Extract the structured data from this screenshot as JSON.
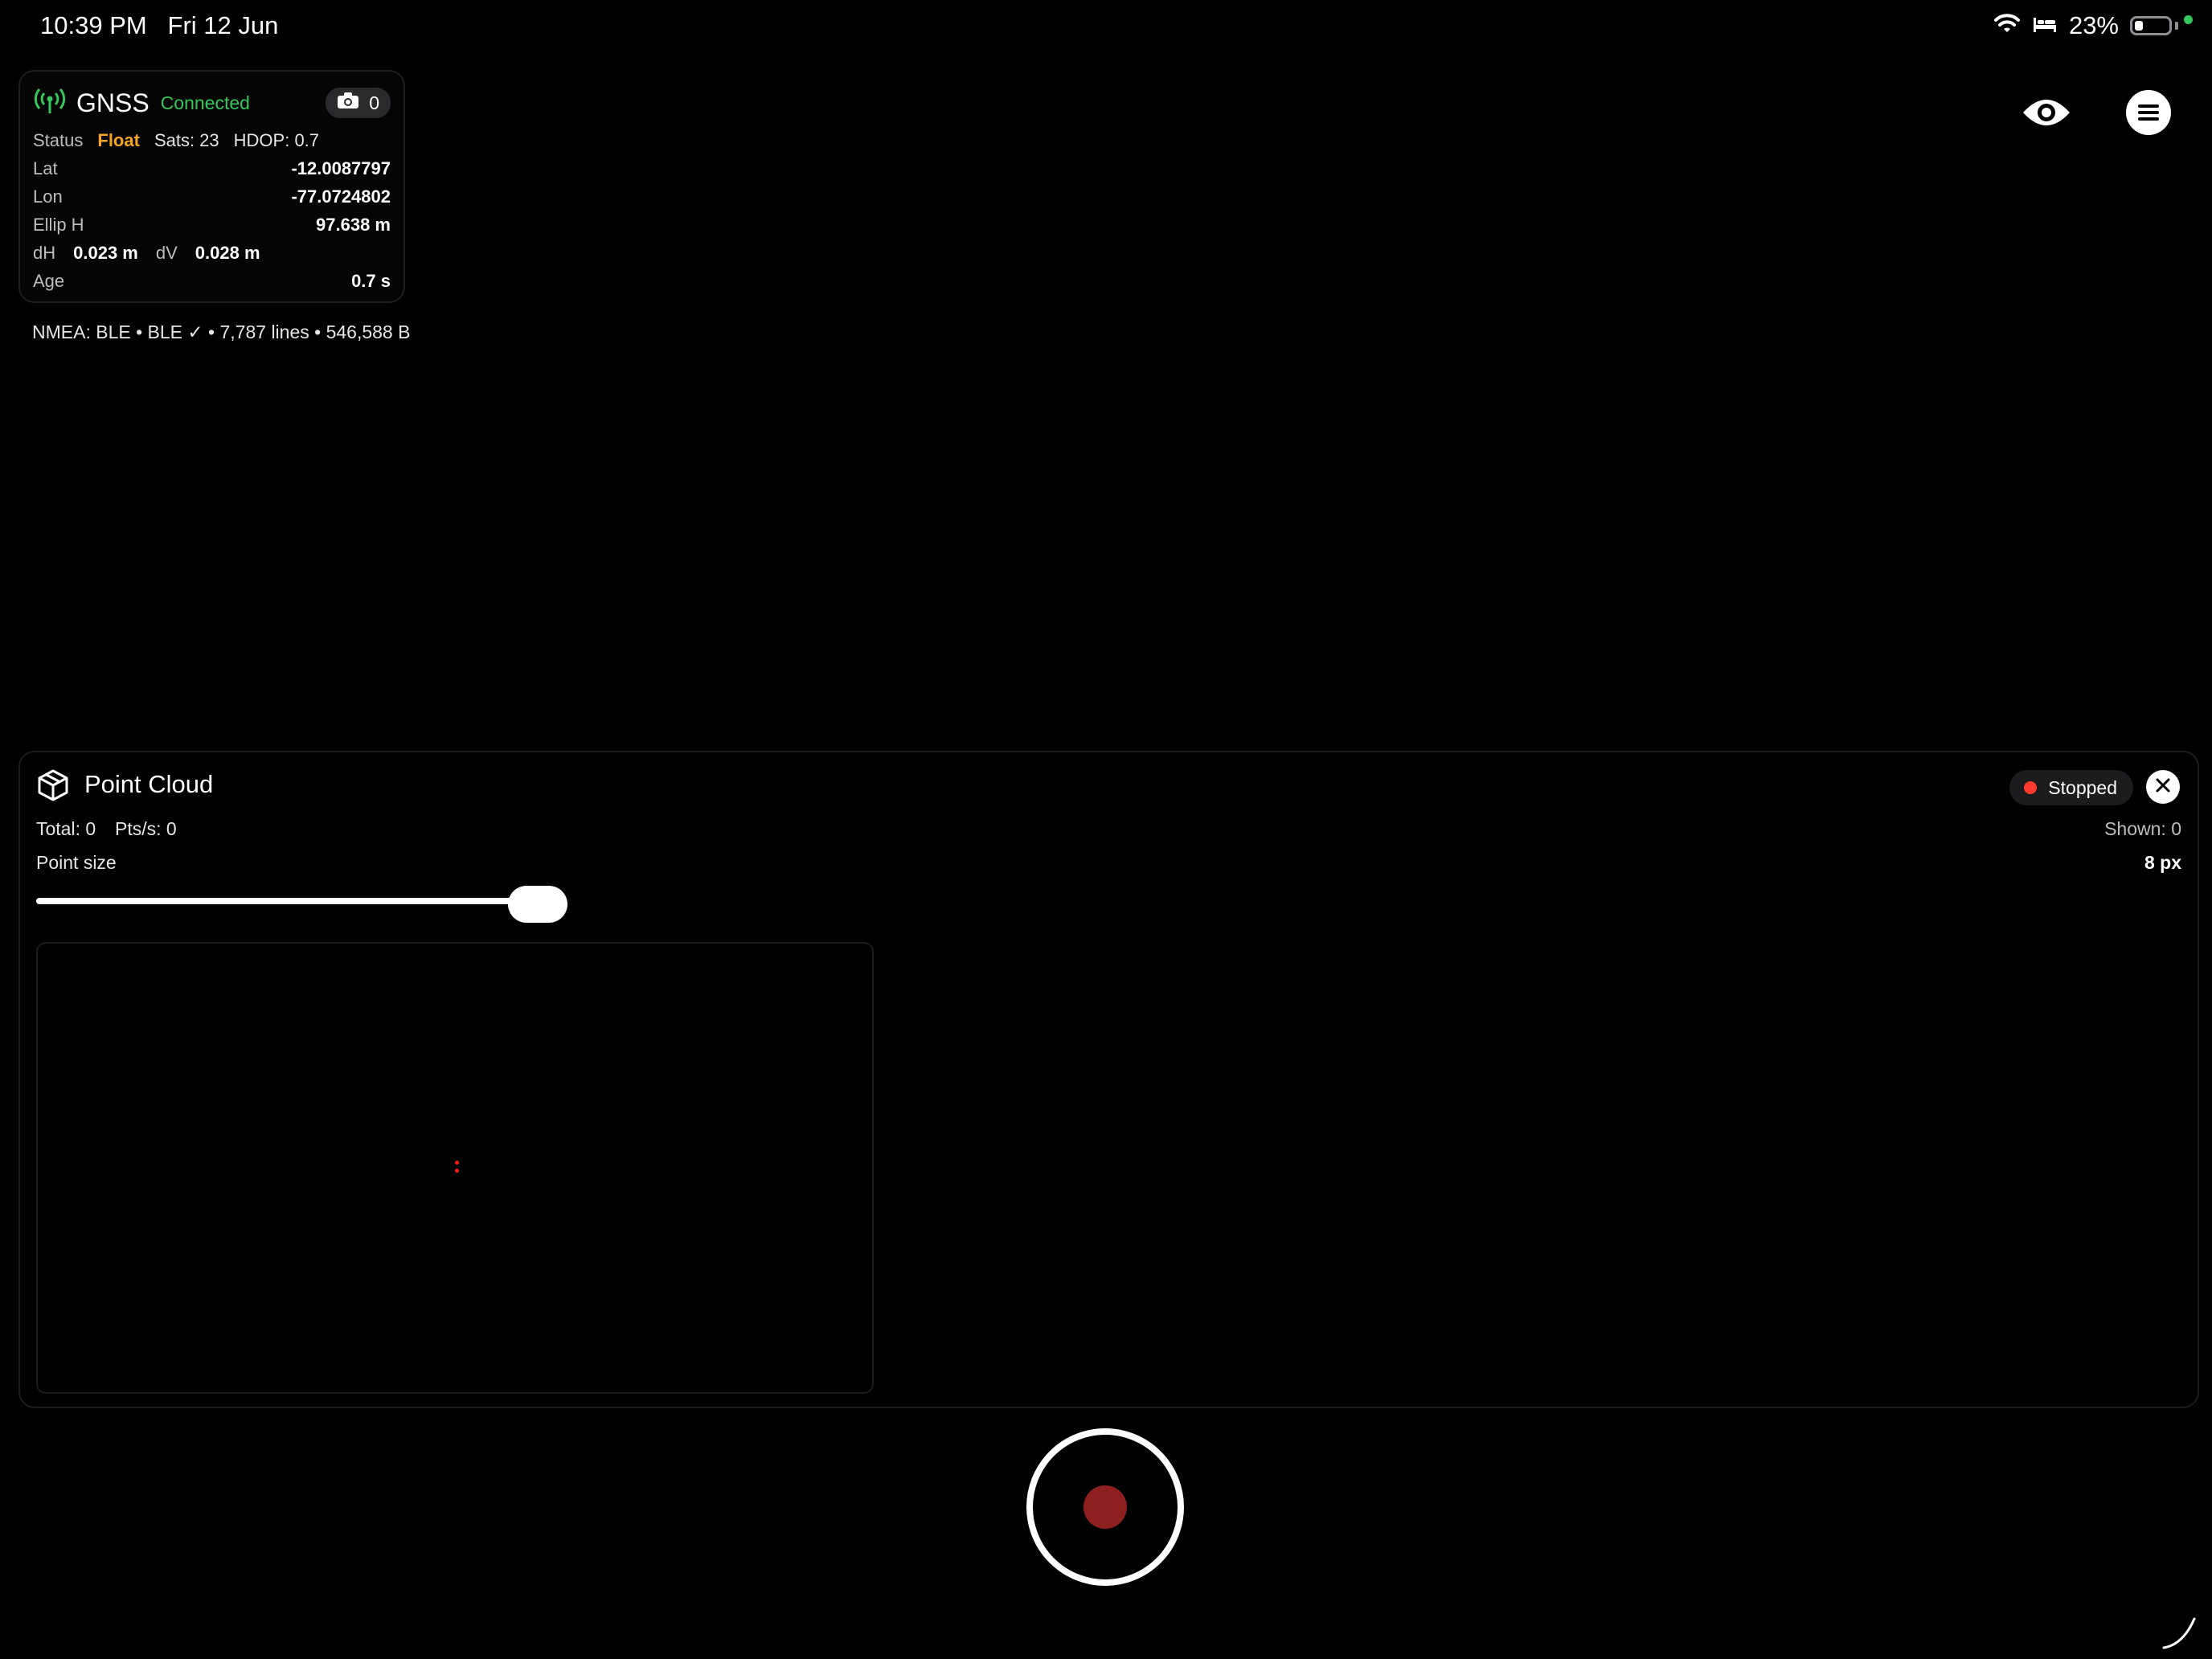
{
  "status_bar": {
    "time": "10:39 PM",
    "date": "Fri 12 Jun",
    "battery": "23%",
    "battery_level": 0.23,
    "icons": [
      "wifi-icon",
      "bed-icon",
      "battery-icon"
    ]
  },
  "gnss": {
    "title": "GNSS",
    "connection": "Connected",
    "photo_count": "0",
    "status_label": "Status",
    "status_value": "Float",
    "sats": "Sats: 23",
    "hdop": "HDOP: 0.7",
    "lat_label": "Lat",
    "lat_value": "-12.0087797",
    "lon_label": "Lon",
    "lon_value": "-77.0724802",
    "ellip_label": "Ellip H",
    "ellip_value": "97.638 m",
    "dh_label": "dH",
    "dh_value": "0.023 m",
    "dv_label": "dV",
    "dv_value": "0.028 m",
    "age_label": "Age",
    "age_value": "0.7 s"
  },
  "nmea": "NMEA: BLE • BLE ✓ • 7,787 lines • 546,588 B",
  "point_cloud": {
    "title": "Point Cloud",
    "state": "Stopped",
    "total": "Total: 0",
    "pts_per_sec": "Pts/s: 0",
    "shown": "Shown: 0",
    "point_size_label": "Point size",
    "point_size_value": "8 px",
    "slider_fraction": 0.9
  },
  "colors": {
    "accent_green": "#34c759",
    "float_orange": "#f5a623",
    "record_red": "#8e1f1f",
    "stopped_red": "#ff3b30"
  }
}
